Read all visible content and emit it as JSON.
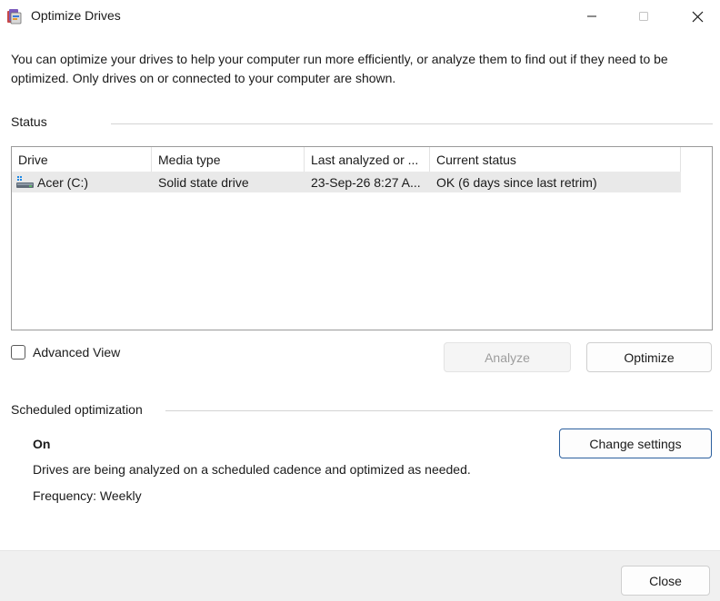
{
  "window": {
    "title": "Optimize Drives",
    "app_icon": "defrag-icon",
    "controls": [
      "minimize-icon",
      "maximize-icon",
      "close-icon"
    ]
  },
  "intro_text": "You can optimize your drives to help your computer run more efficiently, or analyze them to find out if they need to be optimized. Only drives on or connected to your computer are shown.",
  "status_section": {
    "label": "Status",
    "columns": [
      "Drive",
      "Media type",
      "Last analyzed or ...",
      "Current status"
    ],
    "rows": [
      {
        "drive": "Acer (C:)",
        "icon": "drive-icon",
        "media_type": "Solid state drive",
        "last_analyzed": "23-Sep-26 8:27 A...",
        "current_status": "OK (6 days since last retrim)",
        "selected": true
      }
    ]
  },
  "advanced_view": {
    "label": "Advanced View",
    "checked": false
  },
  "buttons": {
    "analyze": "Analyze",
    "optimize": "Optimize",
    "change_settings": "Change settings",
    "close": "Close"
  },
  "scheduled_section": {
    "label": "Scheduled optimization",
    "state": "On",
    "description": "Drives are being analyzed on a scheduled cadence and optimized as needed.",
    "frequency": "Frequency: Weekly"
  }
}
